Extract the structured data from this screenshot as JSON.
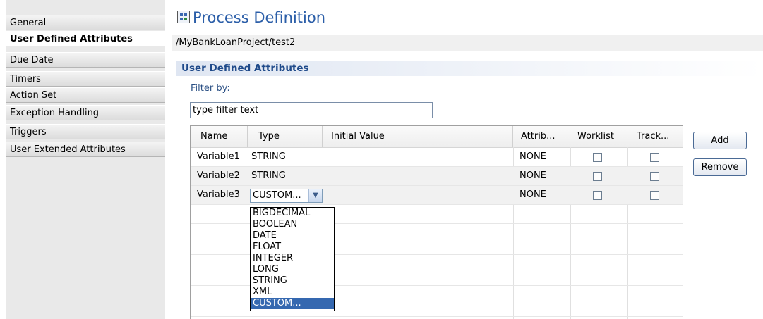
{
  "sidebar": {
    "items": [
      {
        "label": "General",
        "selected": false
      },
      {
        "label": "User Defined Attributes",
        "selected": true
      },
      {
        "label": "Due Date",
        "selected": false
      },
      {
        "label": "Timers",
        "selected": false
      },
      {
        "label": "Action Set",
        "selected": false
      },
      {
        "label": "Exception Handling",
        "selected": false
      },
      {
        "label": "Triggers",
        "selected": false
      },
      {
        "label": "User Extended Attributes",
        "selected": false
      }
    ]
  },
  "header": {
    "title": "Process Definition",
    "path": "/MyBankLoanProject/test2"
  },
  "section": {
    "title": "User Defined Attributes",
    "filter_label": "Filter by:",
    "filter_value": "type filter text"
  },
  "table": {
    "columns": [
      "Name",
      "Type",
      "Initial Value",
      "Attrib...",
      "Worklist",
      "Track..."
    ],
    "rows": [
      {
        "name": "Variable1",
        "type": "STRING",
        "initial": "",
        "attrib": "NONE",
        "worklist": false,
        "track": false
      },
      {
        "name": "Variable2",
        "type": "STRING",
        "initial": "",
        "attrib": "NONE",
        "worklist": false,
        "track": false
      },
      {
        "name": "Variable3",
        "type": "CUSTOM...",
        "initial": "",
        "attrib": "NONE",
        "worklist": false,
        "track": false
      }
    ]
  },
  "type_dropdown": {
    "options": [
      "BIGDECIMAL",
      "BOOLEAN",
      "DATE",
      "FLOAT",
      "INTEGER",
      "LONG",
      "STRING",
      "XML",
      "CUSTOM..."
    ],
    "selected": "CUSTOM..."
  },
  "buttons": {
    "add_label": "Add",
    "remove_label": "Remove"
  },
  "colors": {
    "title": "#2b5ea8",
    "section_title": "#1f4a8a",
    "dropdown_selection": "#3568b0"
  },
  "icons": {
    "title_icon": "process-definition-icon",
    "combo_arrow": "chevron-down-icon"
  }
}
